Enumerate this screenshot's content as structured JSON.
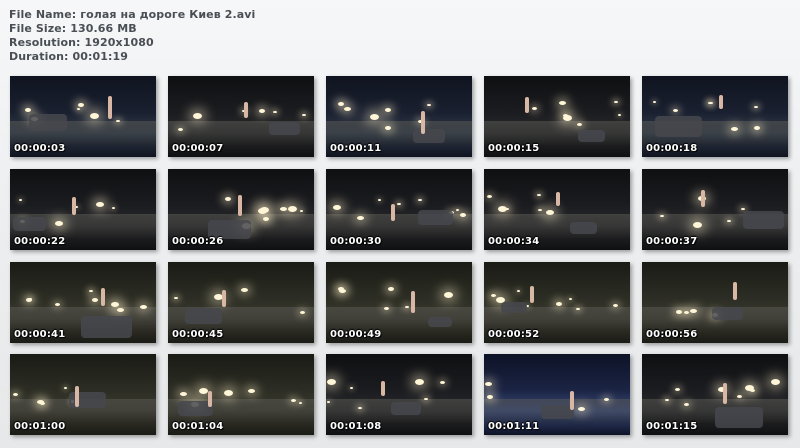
{
  "file_info": {
    "name_line": "File Name: голая на дороге Киев 2.avi",
    "size_line": "File Size: 130.66 MB",
    "resolution_line": "Resolution: 1920x1080",
    "duration_line": "Duration: 00:01:19"
  },
  "frames": [
    {
      "timestamp": "00:00:03",
      "palette": "dark-blue"
    },
    {
      "timestamp": "00:00:07",
      "palette": "dark"
    },
    {
      "timestamp": "00:00:11",
      "palette": "dark-blue"
    },
    {
      "timestamp": "00:00:15",
      "palette": "dark"
    },
    {
      "timestamp": "00:00:18",
      "palette": "dark-blue"
    },
    {
      "timestamp": "00:00:22",
      "palette": "dark"
    },
    {
      "timestamp": "00:00:26",
      "palette": "dark"
    },
    {
      "timestamp": "00:00:30",
      "palette": "dark"
    },
    {
      "timestamp": "00:00:34",
      "palette": "dark"
    },
    {
      "timestamp": "00:00:37",
      "palette": "dark"
    },
    {
      "timestamp": "00:00:41",
      "palette": "olive"
    },
    {
      "timestamp": "00:00:45",
      "palette": "olive"
    },
    {
      "timestamp": "00:00:49",
      "palette": "olive"
    },
    {
      "timestamp": "00:00:52",
      "palette": "olive"
    },
    {
      "timestamp": "00:00:56",
      "palette": "olive"
    },
    {
      "timestamp": "00:01:00",
      "palette": "olive"
    },
    {
      "timestamp": "00:01:04",
      "palette": "olive"
    },
    {
      "timestamp": "00:01:08",
      "palette": "dark"
    },
    {
      "timestamp": "00:01:11",
      "palette": "blue"
    },
    {
      "timestamp": "00:01:15",
      "palette": "dark"
    }
  ],
  "colors": {
    "text": "#4a4f55",
    "timestamp": "#ffffff",
    "night_dark": "#15161a",
    "night_blue": "#1c2233",
    "night_olive": "#2e2e22",
    "headlight": "#fff6d8"
  }
}
